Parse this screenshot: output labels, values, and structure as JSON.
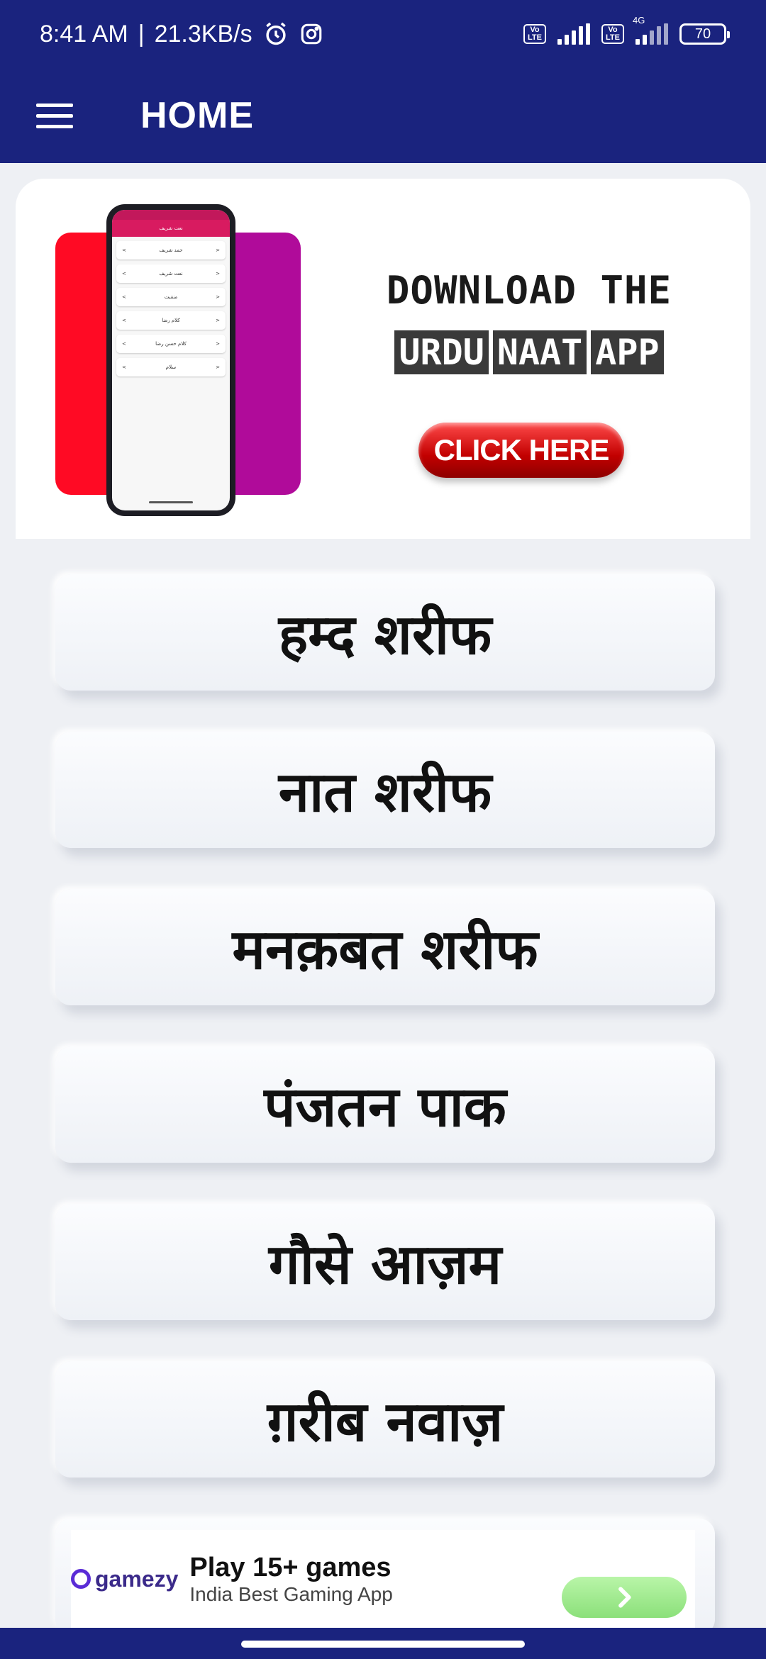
{
  "status_bar": {
    "time": "8:41 AM",
    "separator": "|",
    "net_speed": "21.3KB/s",
    "battery": "70",
    "network_label": "4G",
    "volte_label": "Vo LTE"
  },
  "app_bar": {
    "title": "HOME"
  },
  "banner": {
    "headline": "DOWNLOAD THE",
    "sub_words": [
      "URDU",
      "NAAT",
      "APP"
    ],
    "cta": "CLICK HERE",
    "phone_title": "نعت شریف",
    "phone_items": [
      "حمد شریف",
      "نعت شریف",
      "منقبت",
      "کلام رضا",
      "کلام حسن رضا",
      "سلام"
    ]
  },
  "categories": [
    {
      "label": "हम्द शरीफ"
    },
    {
      "label": "नात शरीफ"
    },
    {
      "label": "मनक़बत शरीफ"
    },
    {
      "label": "पंजतन पाक"
    },
    {
      "label": "गौसे आज़म"
    },
    {
      "label": "ग़रीब नवाज़"
    }
  ],
  "ad": {
    "brand": "gamezy",
    "headline": "Play 15+ games",
    "subtext": "India Best Gaming App"
  },
  "colors": {
    "primary": "#1a237e",
    "banner_red": "#ff0a24",
    "banner_purple": "#b00b9a",
    "cta_red": "#c20000"
  },
  "icons": {
    "menu": "hamburger-menu-icon",
    "alarm": "alarm-icon",
    "instagram": "instagram-icon",
    "ad_arrow": "chevron-right-icon"
  }
}
